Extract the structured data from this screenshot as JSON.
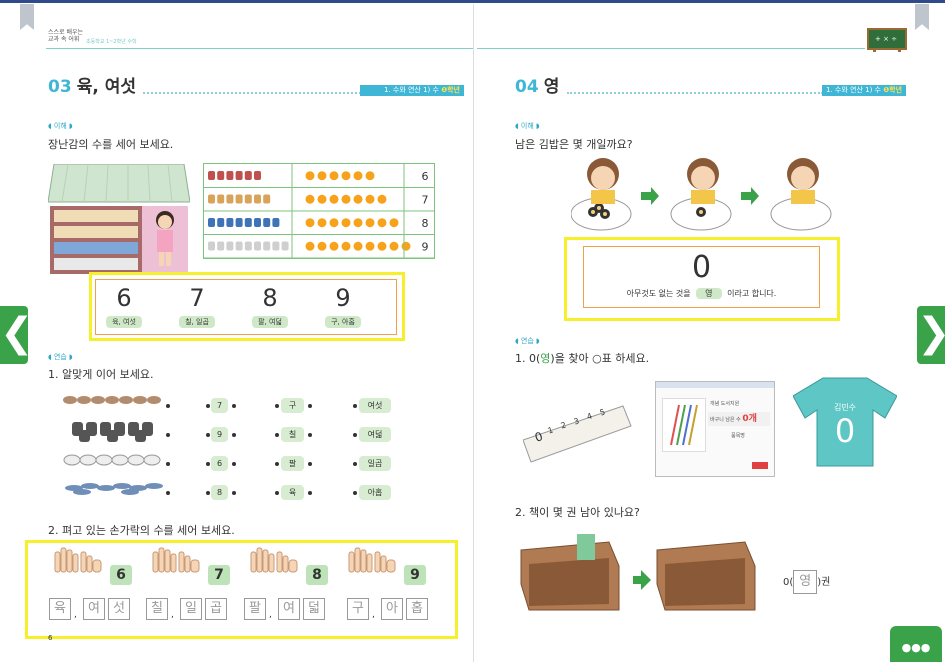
{
  "header": {
    "logo_line1": "스스로 배우는",
    "logo_line2": "교과 속 어휘",
    "subtitle": "초등학교 1~2학년 수학"
  },
  "left_page": {
    "section_number": "03",
    "section_title": "육, 여섯",
    "unit_tag": "1. 수와 연산 1) 수",
    "grade_tag": "❶학년",
    "concept_label": "◖ 이해 ◗",
    "concept_question": "장난감의 수를 세어 보세요.",
    "count_table": {
      "dot_color": "#f7a21b",
      "rows": [
        {
          "dots": 6,
          "number": "6"
        },
        {
          "dots": 7,
          "number": "7"
        },
        {
          "dots": 8,
          "number": "8"
        },
        {
          "dots": 9,
          "number": "9"
        }
      ]
    },
    "number_names": [
      {
        "digit": "6",
        "name": "육, 여섯"
      },
      {
        "digit": "7",
        "name": "칠, 일곱"
      },
      {
        "digit": "8",
        "name": "팔, 여덟"
      },
      {
        "digit": "9",
        "name": "구, 아홉"
      }
    ],
    "practice_label": "◖ 연습 ◗",
    "q1": "1. 알맞게 이어 보세요.",
    "match_numbers": [
      "7",
      "9",
      "6",
      "8"
    ],
    "match_sino": [
      "구",
      "칠",
      "팔",
      "육"
    ],
    "match_native": [
      "여섯",
      "여덟",
      "일곱",
      "아홉"
    ],
    "q2": "2. 펴고 있는 손가락의 수를 세어 보세요.",
    "finger_counts": [
      "6",
      "7",
      "8",
      "9"
    ],
    "trace_groups": [
      [
        "육",
        "여",
        "섯"
      ],
      [
        "칠",
        "일",
        "곱"
      ],
      [
        "팔",
        "여",
        "덟"
      ],
      [
        "구",
        "아",
        "홉"
      ]
    ],
    "page_number": "6"
  },
  "right_page": {
    "section_number": "04",
    "section_title": "영",
    "unit_tag": "1. 수와 연산 1) 수",
    "grade_tag": "❶학년",
    "concept_label": "◖ 이해 ◗",
    "concept_question": "남은 김밥은 몇 개일까요?",
    "zero_digit": "0",
    "zero_sentence_before": "아무것도 없는 것을",
    "zero_word": "영",
    "zero_sentence_after": "이라고 합니다.",
    "practice_label": "◖ 연습 ◗",
    "q1_prefix": "1. 0(",
    "q1_word": "영",
    "q1_suffix": ")을 찾아 ○표 하세요.",
    "ruler_numbers": [
      "0",
      "1",
      "2",
      "3",
      "4",
      "5"
    ],
    "screen_title": "개념 도서지원",
    "screen_value_label": "바구니 남은 수",
    "screen_value": "0개",
    "screen_sub": "품목명",
    "shirt_name": "김민수",
    "shirt_number": "0",
    "q2": "2. 책이 몇 권 남아 있나요?",
    "answer_prefix": "0(",
    "answer_word": "영",
    "answer_suffix": ")권"
  },
  "nav": {
    "prev_symbol": "❮",
    "next_symbol": "❯",
    "more_symbol": "●●●"
  }
}
